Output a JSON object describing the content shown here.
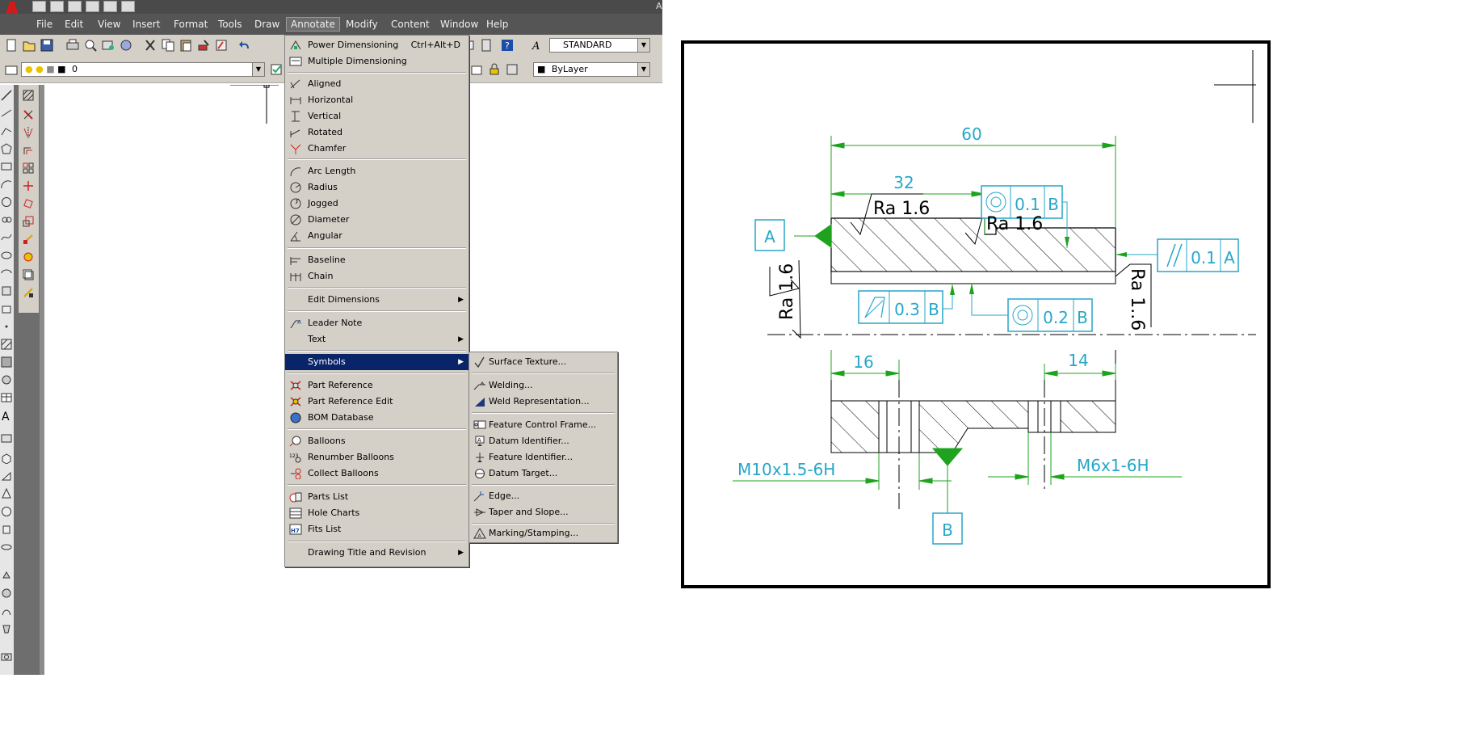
{
  "app": {
    "title_letter": "A",
    "colors": {
      "accent_red": "#d11a1a",
      "menu_highlight": "#0a246a",
      "dim_green": "#1fa31f",
      "tol_cyan": "#27a6c9"
    }
  },
  "menubar": {
    "items": [
      {
        "label": "File"
      },
      {
        "label": "Edit"
      },
      {
        "label": "View"
      },
      {
        "label": "Insert"
      },
      {
        "label": "Format"
      },
      {
        "label": "Tools"
      },
      {
        "label": "Draw"
      },
      {
        "label": "Annotate"
      },
      {
        "label": "Modify"
      },
      {
        "label": "Content"
      },
      {
        "label": "Window"
      },
      {
        "label": "Help"
      }
    ]
  },
  "toolbar": {
    "text_style": "STANDARD",
    "layer": "0",
    "color_value": "ByLayer"
  },
  "annotate_menu": {
    "items": [
      {
        "label": "Power Dimensioning",
        "shortcut": "Ctrl+Alt+D"
      },
      {
        "label": "Multiple Dimensioning"
      },
      {
        "label": "Aligned"
      },
      {
        "label": "Horizontal"
      },
      {
        "label": "Vertical"
      },
      {
        "label": "Rotated"
      },
      {
        "label": "Chamfer"
      },
      {
        "label": "Arc Length"
      },
      {
        "label": "Radius"
      },
      {
        "label": "Jogged"
      },
      {
        "label": "Diameter"
      },
      {
        "label": "Angular"
      },
      {
        "label": "Baseline"
      },
      {
        "label": "Chain"
      },
      {
        "label": "Edit Dimensions"
      },
      {
        "label": "Leader Note"
      },
      {
        "label": "Text"
      },
      {
        "label": "Symbols"
      },
      {
        "label": "Part Reference"
      },
      {
        "label": "Part Reference Edit"
      },
      {
        "label": "BOM Database"
      },
      {
        "label": "Balloons"
      },
      {
        "label": "Renumber Balloons"
      },
      {
        "label": "Collect Balloons"
      },
      {
        "label": "Parts List"
      },
      {
        "label": "Hole Charts"
      },
      {
        "label": "Fits List"
      },
      {
        "label": "Drawing Title and Revision"
      }
    ]
  },
  "symbols_submenu": {
    "items": [
      {
        "label": "Surface Texture..."
      },
      {
        "label": "Welding..."
      },
      {
        "label": "Weld Representation..."
      },
      {
        "label": "Feature Control Frame..."
      },
      {
        "label": "Datum Identifier..."
      },
      {
        "label": "Feature Identifier..."
      },
      {
        "label": "Datum Target..."
      },
      {
        "label": "Edge..."
      },
      {
        "label": "Taper and Slope..."
      },
      {
        "label": "Marking/Stamping..."
      }
    ]
  },
  "drawing": {
    "dims": {
      "d60": "60",
      "d32": "32",
      "d16": "16",
      "d14": "14",
      "thread_left": "M10x1.5-6H",
      "thread_right": "M6x1-6H"
    },
    "roughness": {
      "r1": "Ra 1.6",
      "r2": "Ra 1.6",
      "r3": "Ra 1.6",
      "r4": "Ra 1..6"
    },
    "datums": {
      "a": "A",
      "b": "B"
    },
    "fcf": {
      "f1": {
        "tol": "0.1",
        "datum": "B"
      },
      "f2": {
        "tol": "0.1",
        "datum": "A"
      },
      "f3": {
        "tol": "0.3",
        "datum": "B"
      },
      "f4": {
        "tol": "0.2",
        "datum": "B"
      }
    }
  }
}
